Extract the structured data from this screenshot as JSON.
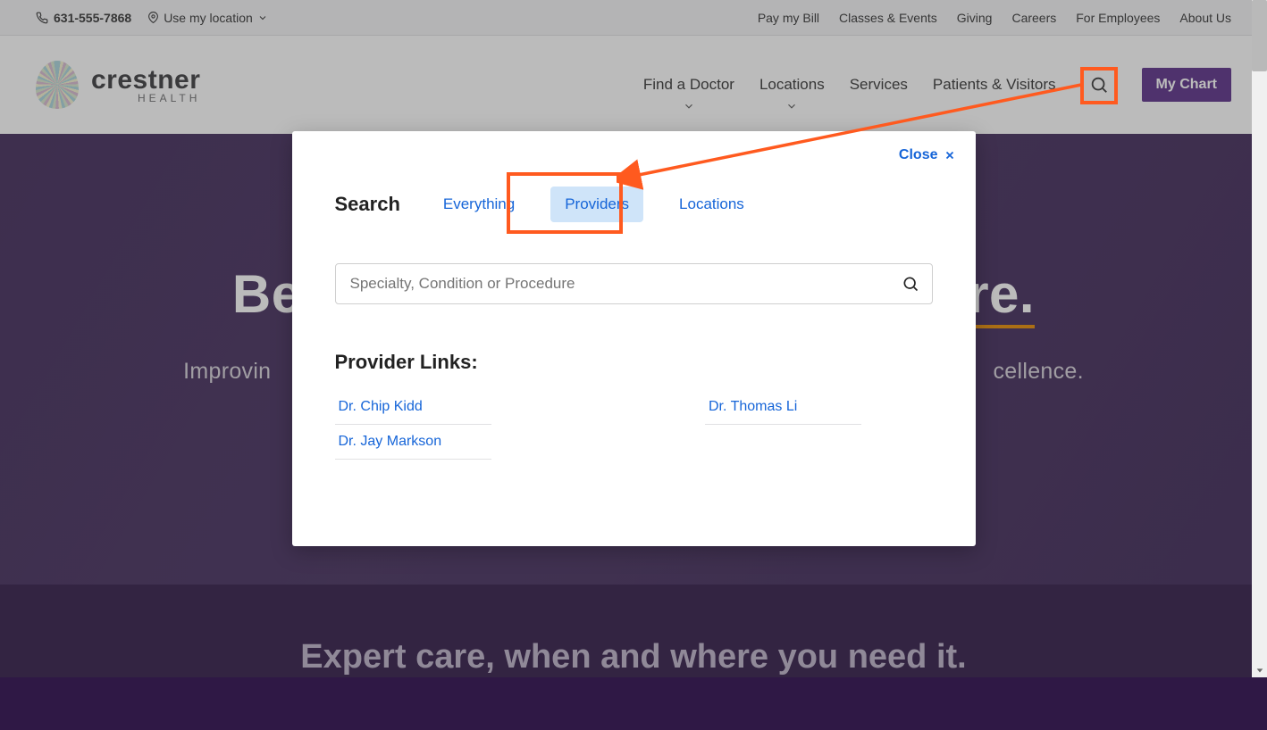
{
  "util": {
    "phone": "631-555-7868",
    "location_label": "Use my location",
    "links": [
      {
        "label": "Pay my Bill"
      },
      {
        "label": "Classes & Events"
      },
      {
        "label": "Giving"
      },
      {
        "label": "Careers"
      },
      {
        "label": "For Employees"
      },
      {
        "label": "About Us"
      }
    ]
  },
  "brand": {
    "name": "crestner",
    "tag": "HEALTH"
  },
  "nav": {
    "items": [
      {
        "label": "Find a Doctor",
        "has_menu": true
      },
      {
        "label": "Locations",
        "has_menu": true
      },
      {
        "label": "Services"
      },
      {
        "label": "Patients & Visitors"
      }
    ],
    "cta": "My Chart"
  },
  "hero": {
    "title_prefix": "Be",
    "title_suffix": "re.",
    "subtitle_prefix": "Improvin",
    "subtitle_suffix": "cellence."
  },
  "band": {
    "message": "Expert care, when and where you need it."
  },
  "modal": {
    "close_label": "Close",
    "search_label": "Search",
    "tabs": [
      {
        "label": "Everything"
      },
      {
        "label": "Providers",
        "active": true
      },
      {
        "label": "Locations"
      }
    ],
    "search_placeholder": "Specialty, Condition or Procedure",
    "provider_links_title": "Provider Links:",
    "provider_links_col1": [
      {
        "label": "Dr. Chip Kidd"
      },
      {
        "label": "Dr. Jay Markson"
      }
    ],
    "provider_links_col2": [
      {
        "label": "Dr. Thomas Li"
      }
    ]
  },
  "annotations": {
    "search_icon_highlighted": true,
    "providers_tab_highlighted": true,
    "arrow_from_to": "search-icon → providers-tab"
  }
}
